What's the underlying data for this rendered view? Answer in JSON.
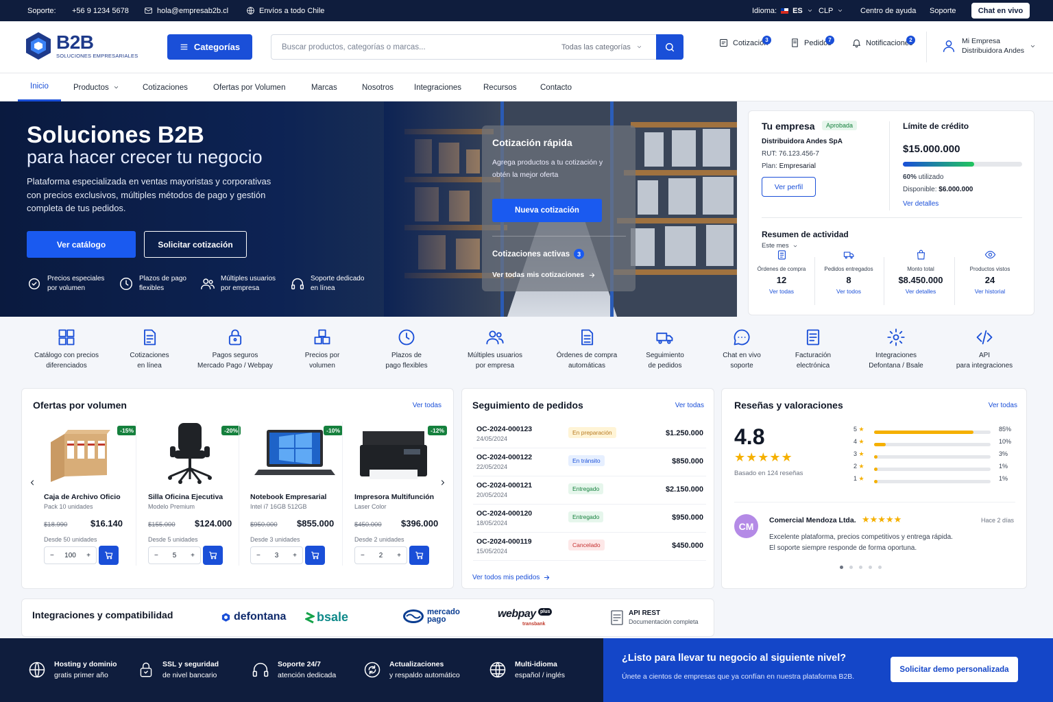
{
  "topbar": {
    "support_label": "Soporte:",
    "phone": "+56 9 1234 5678",
    "email": "hola@empresab2b.cl",
    "shipping": "Envíos a todo Chile",
    "language_label": "Idioma:",
    "language_value": "ES",
    "currency": "CLP",
    "help_center": "Centro de ayuda",
    "support": "Soporte",
    "live_chat": "Chat en vivo"
  },
  "header": {
    "logo_name": "B2B",
    "logo_sub": "SOLUCIONES EMPRESARIALES",
    "categories_button": "Categorías",
    "search_placeholder": "Buscar productos, categorías o marcas...",
    "search_category": "Todas las categorías",
    "quote_label": "Cotización",
    "quote_count": "3",
    "orders_label": "Pedidos",
    "orders_count": "7",
    "notifications_label": "Notificaciones",
    "notifications_count": "2",
    "account_title": "Mi Empresa",
    "account_company": "Distribuidora Andes"
  },
  "nav": [
    "Inicio",
    "Productos",
    "Cotizaciones",
    "Ofertas por Volumen",
    "Marcas",
    "Nosotros",
    "Integraciones",
    "Recursos",
    "Contacto"
  ],
  "hero": {
    "title": "Soluciones B2B",
    "subtitle": "para hacer crecer tu negocio",
    "description": "Plataforma especializada en ventas mayoristas y corporativas con precios exclusivos, múltiples métodos de pago y gestión completa de tus pedidos.",
    "primary_button": "Ver catálogo",
    "secondary_button": "Solicitar cotización",
    "features": [
      {
        "l1": "Precios especiales",
        "l2": "por volumen"
      },
      {
        "l1": "Plazos de pago",
        "l2": "flexibles"
      },
      {
        "l1": "Múltiples usuarios",
        "l2": "por empresa"
      },
      {
        "l1": "Soporte dedicado",
        "l2": "en línea"
      }
    ]
  },
  "quick_quote": {
    "title": "Cotización rápida",
    "description": "Agrega productos a tu cotización y obtén la mejor oferta",
    "button": "Nueva cotización",
    "active_label": "Cotizaciones activas",
    "active_count": "3",
    "view_all": "Ver todas mis cotizaciones"
  },
  "company": {
    "title": "Tu empresa",
    "status": "Aprobada",
    "name": "Distribuidora Andes SpA",
    "rut_label": "RUT:",
    "rut": "76.123.456-7",
    "plan_label": "Plan:",
    "plan": "Empresarial",
    "profile_button": "Ver perfil",
    "credit_title": "Límite de crédito",
    "credit_amount": "$15.000.000",
    "credit_used_fraction": 0.6,
    "used_pct": "60%",
    "used_label": "utilizado",
    "available_label": "Disponible:",
    "available": "$6.000.000",
    "details_link": "Ver detalles",
    "activity_title": "Resumen de actividad",
    "activity_period": "Este mes",
    "activity": [
      {
        "label": "Órdenes de compra",
        "value": "12",
        "link": "Ver todas"
      },
      {
        "label": "Pedidos entregados",
        "value": "8",
        "link": "Ver todos"
      },
      {
        "label": "Monto total",
        "value": "$8.450.000",
        "link": "Ver detalles"
      },
      {
        "label": "Productos vistos",
        "value": "24",
        "link": "Ver historial"
      }
    ]
  },
  "features": [
    {
      "l1": "Catálogo con precios",
      "l2": "diferenciados"
    },
    {
      "l1": "Cotizaciones",
      "l2": "en línea"
    },
    {
      "l1": "Pagos seguros",
      "l2": "Mercado Pago / Webpay"
    },
    {
      "l1": "Precios por",
      "l2": "volumen"
    },
    {
      "l1": "Plazos de",
      "l2": "pago flexibles"
    },
    {
      "l1": "Múltiples usuarios",
      "l2": "por empresa"
    },
    {
      "l1": "Órdenes de compra",
      "l2": "automáticas"
    },
    {
      "l1": "Seguimiento",
      "l2": "de pedidos"
    },
    {
      "l1": "Chat en vivo",
      "l2": "soporte"
    },
    {
      "l1": "Facturación",
      "l2": "electrónica"
    },
    {
      "l1": "Integraciones",
      "l2": "Defontana / Bsale"
    },
    {
      "l1": "API",
      "l2": "para integraciones"
    }
  ],
  "offers": {
    "title": "Ofertas por volumen",
    "view_all": "Ver todas",
    "products": [
      {
        "name": "Caja de Archivo Oficio",
        "model": "Pack 10 unidades",
        "old": "$18.990",
        "price": "$16.140",
        "min": "Desde 50 unidades",
        "qty": "100",
        "discount": "-15%"
      },
      {
        "name": "Silla Oficina Ejecutiva",
        "model": "Modelo Premium",
        "old": "$155.000",
        "price": "$124.000",
        "min": "Desde 5 unidades",
        "qty": "5",
        "discount": "-20%"
      },
      {
        "name": "Notebook Empresarial",
        "model": "Intel i7 16GB 512GB",
        "old": "$950.000",
        "price": "$855.000",
        "min": "Desde 3 unidades",
        "qty": "3",
        "discount": "-10%"
      },
      {
        "name": "Impresora Multifunción",
        "model": "Laser Color",
        "old": "$450.000",
        "price": "$396.000",
        "min": "Desde 2 unidades",
        "qty": "2",
        "discount": "-12%"
      }
    ]
  },
  "orders": {
    "title": "Seguimiento de pedidos",
    "view_all": "Ver todas",
    "rows": [
      {
        "id": "OC-2024-000123",
        "date": "24/05/2024",
        "status": "En preparación",
        "amount": "$1.250.000"
      },
      {
        "id": "OC-2024-000122",
        "date": "22/05/2024",
        "status": "En tránsito",
        "amount": "$850.000"
      },
      {
        "id": "OC-2024-000121",
        "date": "20/05/2024",
        "status": "Entregado",
        "amount": "$2.150.000"
      },
      {
        "id": "OC-2024-000120",
        "date": "18/05/2024",
        "status": "Entregado",
        "amount": "$950.000"
      },
      {
        "id": "OC-2024-000119",
        "date": "15/05/2024",
        "status": "Cancelado",
        "amount": "$450.000"
      }
    ],
    "view_orders": "Ver todos mis pedidos"
  },
  "reviews": {
    "title": "Reseñas y valoraciones",
    "view_all": "Ver todas",
    "score": "4.8",
    "based_on": "Basado en 124 reseñas",
    "distribution": [
      {
        "stars": "5",
        "pct": "85%",
        "fraction": 0.85
      },
      {
        "stars": "4",
        "pct": "10%",
        "fraction": 0.1
      },
      {
        "stars": "3",
        "pct": "3%",
        "fraction": 0.03
      },
      {
        "stars": "2",
        "pct": "1%",
        "fraction": 0.01
      },
      {
        "stars": "1",
        "pct": "1%",
        "fraction": 0.01
      }
    ],
    "review_initials": "CM",
    "review_author": "Comercial Mendoza Ltda.",
    "review_time": "Hace 2 días",
    "review_text_1": "Excelente plataforma, precios competitivos y entrega rápida.",
    "review_text_2": "El soporte siempre responde de forma oportuna."
  },
  "integrations": {
    "title": "Integraciones y compatibilidad",
    "defontana": "defontana",
    "bsale": "bsale",
    "mercado_1": "mercado",
    "mercado_2": "pago",
    "webpay": "webpay",
    "webpay_plus": "plus",
    "transbank": "transbank",
    "api_title": "API REST",
    "api_sub": "Documentación completa"
  },
  "footer": {
    "items": [
      {
        "l1": "Hosting y dominio",
        "l2": "gratis primer año"
      },
      {
        "l1": "SSL y seguridad",
        "l2": "de nivel bancario"
      },
      {
        "l1": "Soporte 24/7",
        "l2": "atención dedicada"
      },
      {
        "l1": "Actualizaciones",
        "l2": "y respaldo automático"
      },
      {
        "l1": "Multi-idioma",
        "l2": "español / inglés"
      }
    ],
    "cta_title": "¿Listo para llevar tu negocio al siguiente nivel?",
    "cta_text": "Únete a cientos de empresas que ya confían en nuestra plataforma B2B.",
    "cta_button": "Solicitar demo personalizada"
  },
  "colors": {
    "primary": "#1a4fd8",
    "navy": "#0f1d3d",
    "success": "#15803d",
    "star": "#f5b000"
  }
}
